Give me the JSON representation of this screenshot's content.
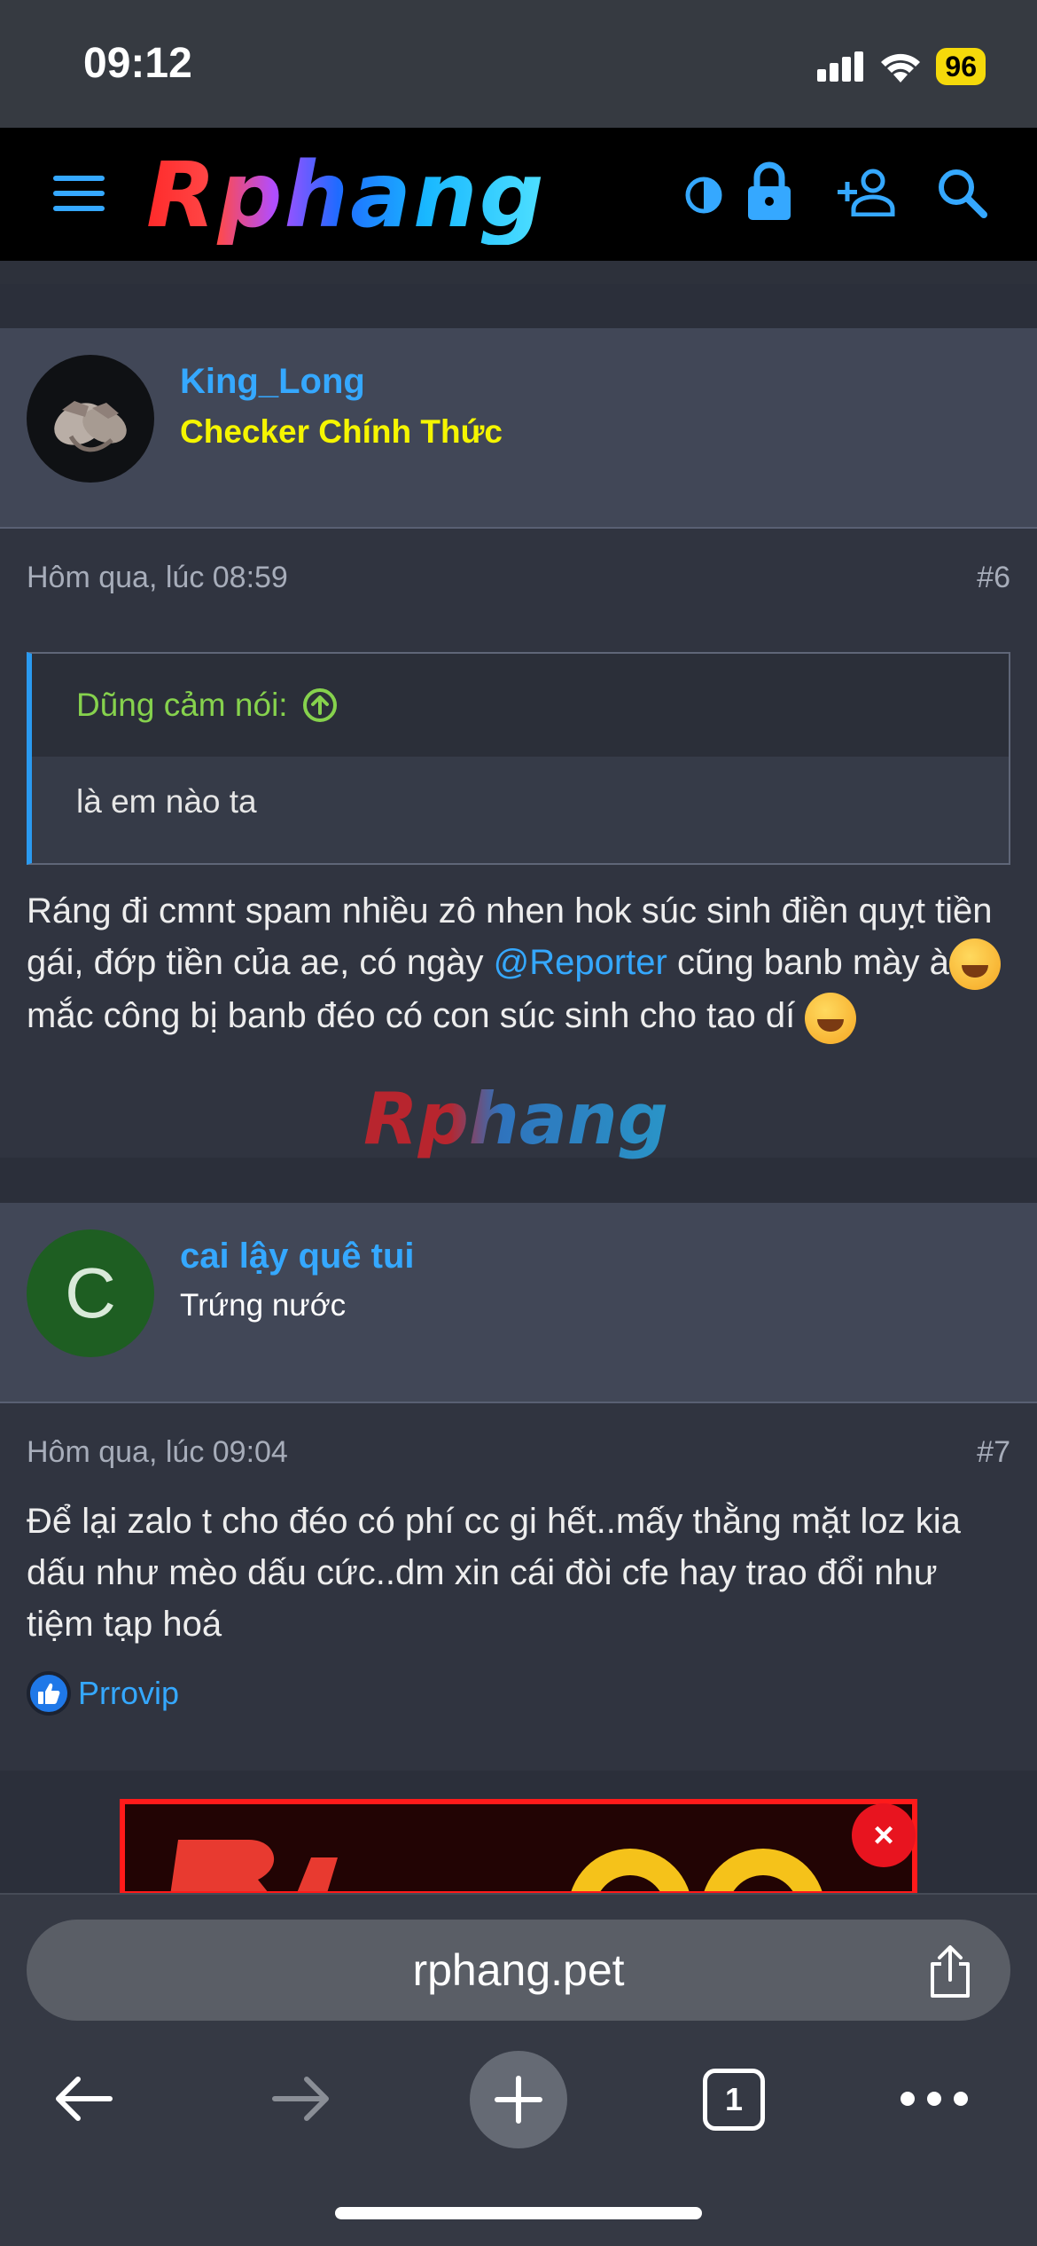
{
  "status_bar": {
    "time": "09:12",
    "battery": "96"
  },
  "header": {
    "logo": "Rphang",
    "icons": [
      "menu-icon",
      "theme-toggle-icon",
      "lock-icon",
      "add-user-icon",
      "search-icon"
    ]
  },
  "posts": [
    {
      "username": "King_Long",
      "user_title": "Checker Chính Thức",
      "user_title_color": "#f5f500",
      "timestamp": "Hôm qua, lúc 08:59",
      "number": "#6",
      "quote": {
        "author": "Dũng cảm nói:",
        "text": "là em nào ta"
      },
      "body_part1": "Ráng đi cmnt spam nhiều zô nhen hok súc sinh điền quỵt tiền gái, đớp tiền của ae, có ngày ",
      "mention": "@Reporter",
      "body_part2": " cũng banb mày à",
      "body_part3": " mắc công bị banb đéo có con súc sinh cho tao dí ",
      "watermark": "Rphang"
    },
    {
      "username": "cai lậy quê tui",
      "user_title": "Trứng nước",
      "avatar_letter": "C",
      "avatar_color": "#1e5e22",
      "timestamp": "Hôm qua, lúc 09:04",
      "number": "#7",
      "body": "Để lại zalo t cho đéo có phí cc gi hết..mấy thằng mặt loz kia dấu như mèo dấu cức..dm xin cái đòi cfe hay trao đổi như tiệm tạp hoá",
      "reaction_user": "Prrovip"
    }
  ],
  "ad": {
    "close_label": "×"
  },
  "browser": {
    "url": "rphang.pet",
    "tab_count": "1"
  },
  "colors": {
    "accent": "#35a8ff",
    "quote_author": "#86d24d",
    "background": "#2b2f3a"
  }
}
